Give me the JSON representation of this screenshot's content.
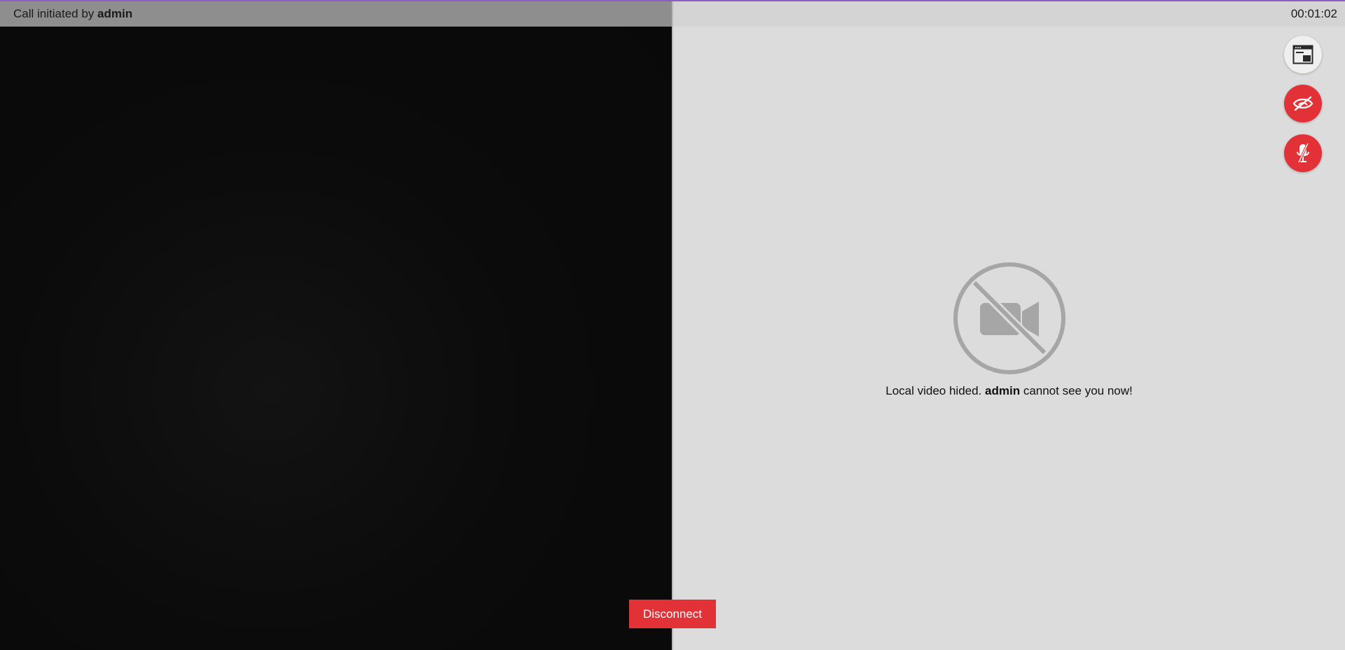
{
  "remote": {
    "header_prefix": "Call initiated by",
    "initiator": "admin"
  },
  "local": {
    "timer": "00:01:02",
    "message_prefix": "Local video hided.",
    "message_user": "admin",
    "message_suffix": "cannot see you now!"
  },
  "controls": {
    "layout_icon": "picture-in-picture-icon",
    "video_icon": "eye-off-icon",
    "mic_icon": "mic-off-icon"
  },
  "actions": {
    "disconnect_label": "Disconnect"
  },
  "colors": {
    "accent": "#8a5cc4",
    "danger": "#e23137",
    "remote_header_bg": "#8e8e8e",
    "local_bg": "#dcdcdc"
  }
}
